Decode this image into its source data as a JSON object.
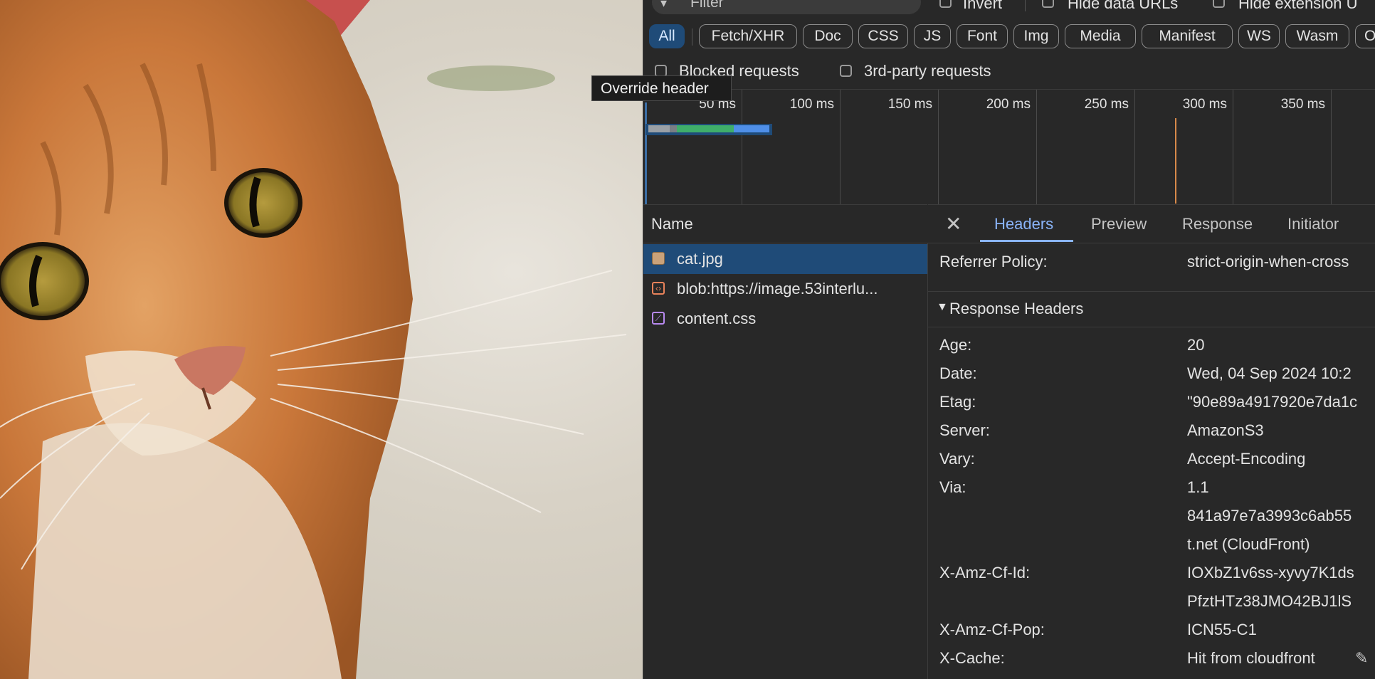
{
  "filter": {
    "placeholder": "Filter",
    "invert_label": "Invert",
    "hide_data_urls_label": "Hide data URLs",
    "hide_extension_label": "Hide extension U"
  },
  "types": [
    "All",
    "Fetch/XHR",
    "Doc",
    "CSS",
    "JS",
    "Font",
    "Img",
    "Media",
    "Manifest",
    "WS",
    "Wasm",
    "Othe"
  ],
  "checkboxes": {
    "blocked": "Blocked requests",
    "third_party": "3rd-party requests"
  },
  "tooltip": "Override header",
  "timeline": {
    "ticks": [
      "50 ms",
      "100 ms",
      "150 ms",
      "200 ms",
      "250 ms",
      "300 ms",
      "350 ms"
    ]
  },
  "list": {
    "header": "Name",
    "rows": [
      {
        "name": "cat.jpg"
      },
      {
        "name": "blob:https://image.53interlu..."
      },
      {
        "name": "content.css"
      }
    ]
  },
  "detail": {
    "tabs": [
      "Headers",
      "Preview",
      "Response",
      "Initiator"
    ],
    "referrer": {
      "key": "Referrer Policy:",
      "value": "strict-origin-when-cross"
    },
    "section": "Response Headers",
    "headers": [
      {
        "key": "Age:",
        "value": "20"
      },
      {
        "key": "Date:",
        "value": "Wed, 04 Sep 2024 10:2"
      },
      {
        "key": "Etag:",
        "value": "\"90e89a4917920e7da1c"
      },
      {
        "key": "Server:",
        "value": "AmazonS3"
      },
      {
        "key": "Vary:",
        "value": "Accept-Encoding"
      },
      {
        "key": "Via:",
        "value": "1.1"
      },
      {
        "key": "",
        "value": "841a97e7a3993c6ab55"
      },
      {
        "key": "",
        "value": "t.net (CloudFront)"
      },
      {
        "key": "X-Amz-Cf-Id:",
        "value": "IOXbZ1v6ss-xyvy7K1ds"
      },
      {
        "key": "",
        "value": "PfztHTz38JMO42BJ1lS"
      },
      {
        "key": "X-Amz-Cf-Pop:",
        "value": "ICN55-C1"
      },
      {
        "key": "X-Cache:",
        "value": "Hit from cloudfront"
      }
    ]
  }
}
